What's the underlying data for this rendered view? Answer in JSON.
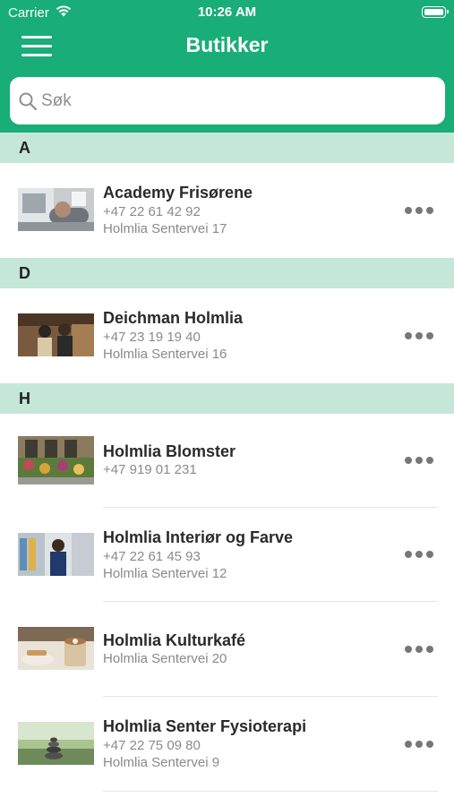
{
  "status_bar": {
    "carrier": "Carrier",
    "time": "10:26 AM"
  },
  "nav": {
    "title": "Butikker"
  },
  "search": {
    "placeholder": "Søk"
  },
  "sections": [
    {
      "letter": "A"
    },
    {
      "letter": "D"
    },
    {
      "letter": "H"
    }
  ],
  "stores": [
    {
      "name": "Academy Frisørene",
      "phone": "+47 22 61 42 92",
      "address": "Holmlia Sentervei 17"
    },
    {
      "name": "Deichman Holmlia",
      "phone": "+47 23 19 19 40",
      "address": "Holmlia Sentervei 16"
    },
    {
      "name": "Holmlia Blomster",
      "phone": "+47 919 01 231"
    },
    {
      "name": "Holmlia Interiør og Farve",
      "phone": "+47 22 61 45 93",
      "address": "Holmlia Sentervei 12"
    },
    {
      "name": "Holmlia Kulturkafé",
      "address": "Holmlia Sentervei 20"
    },
    {
      "name": "Holmlia Senter Fysioterapi",
      "phone": "+47 22 75 09 80",
      "address": "Holmlia Sentervei 9"
    }
  ],
  "colors": {
    "accent": "#19ad77",
    "section_bg": "#c4e7d8"
  }
}
